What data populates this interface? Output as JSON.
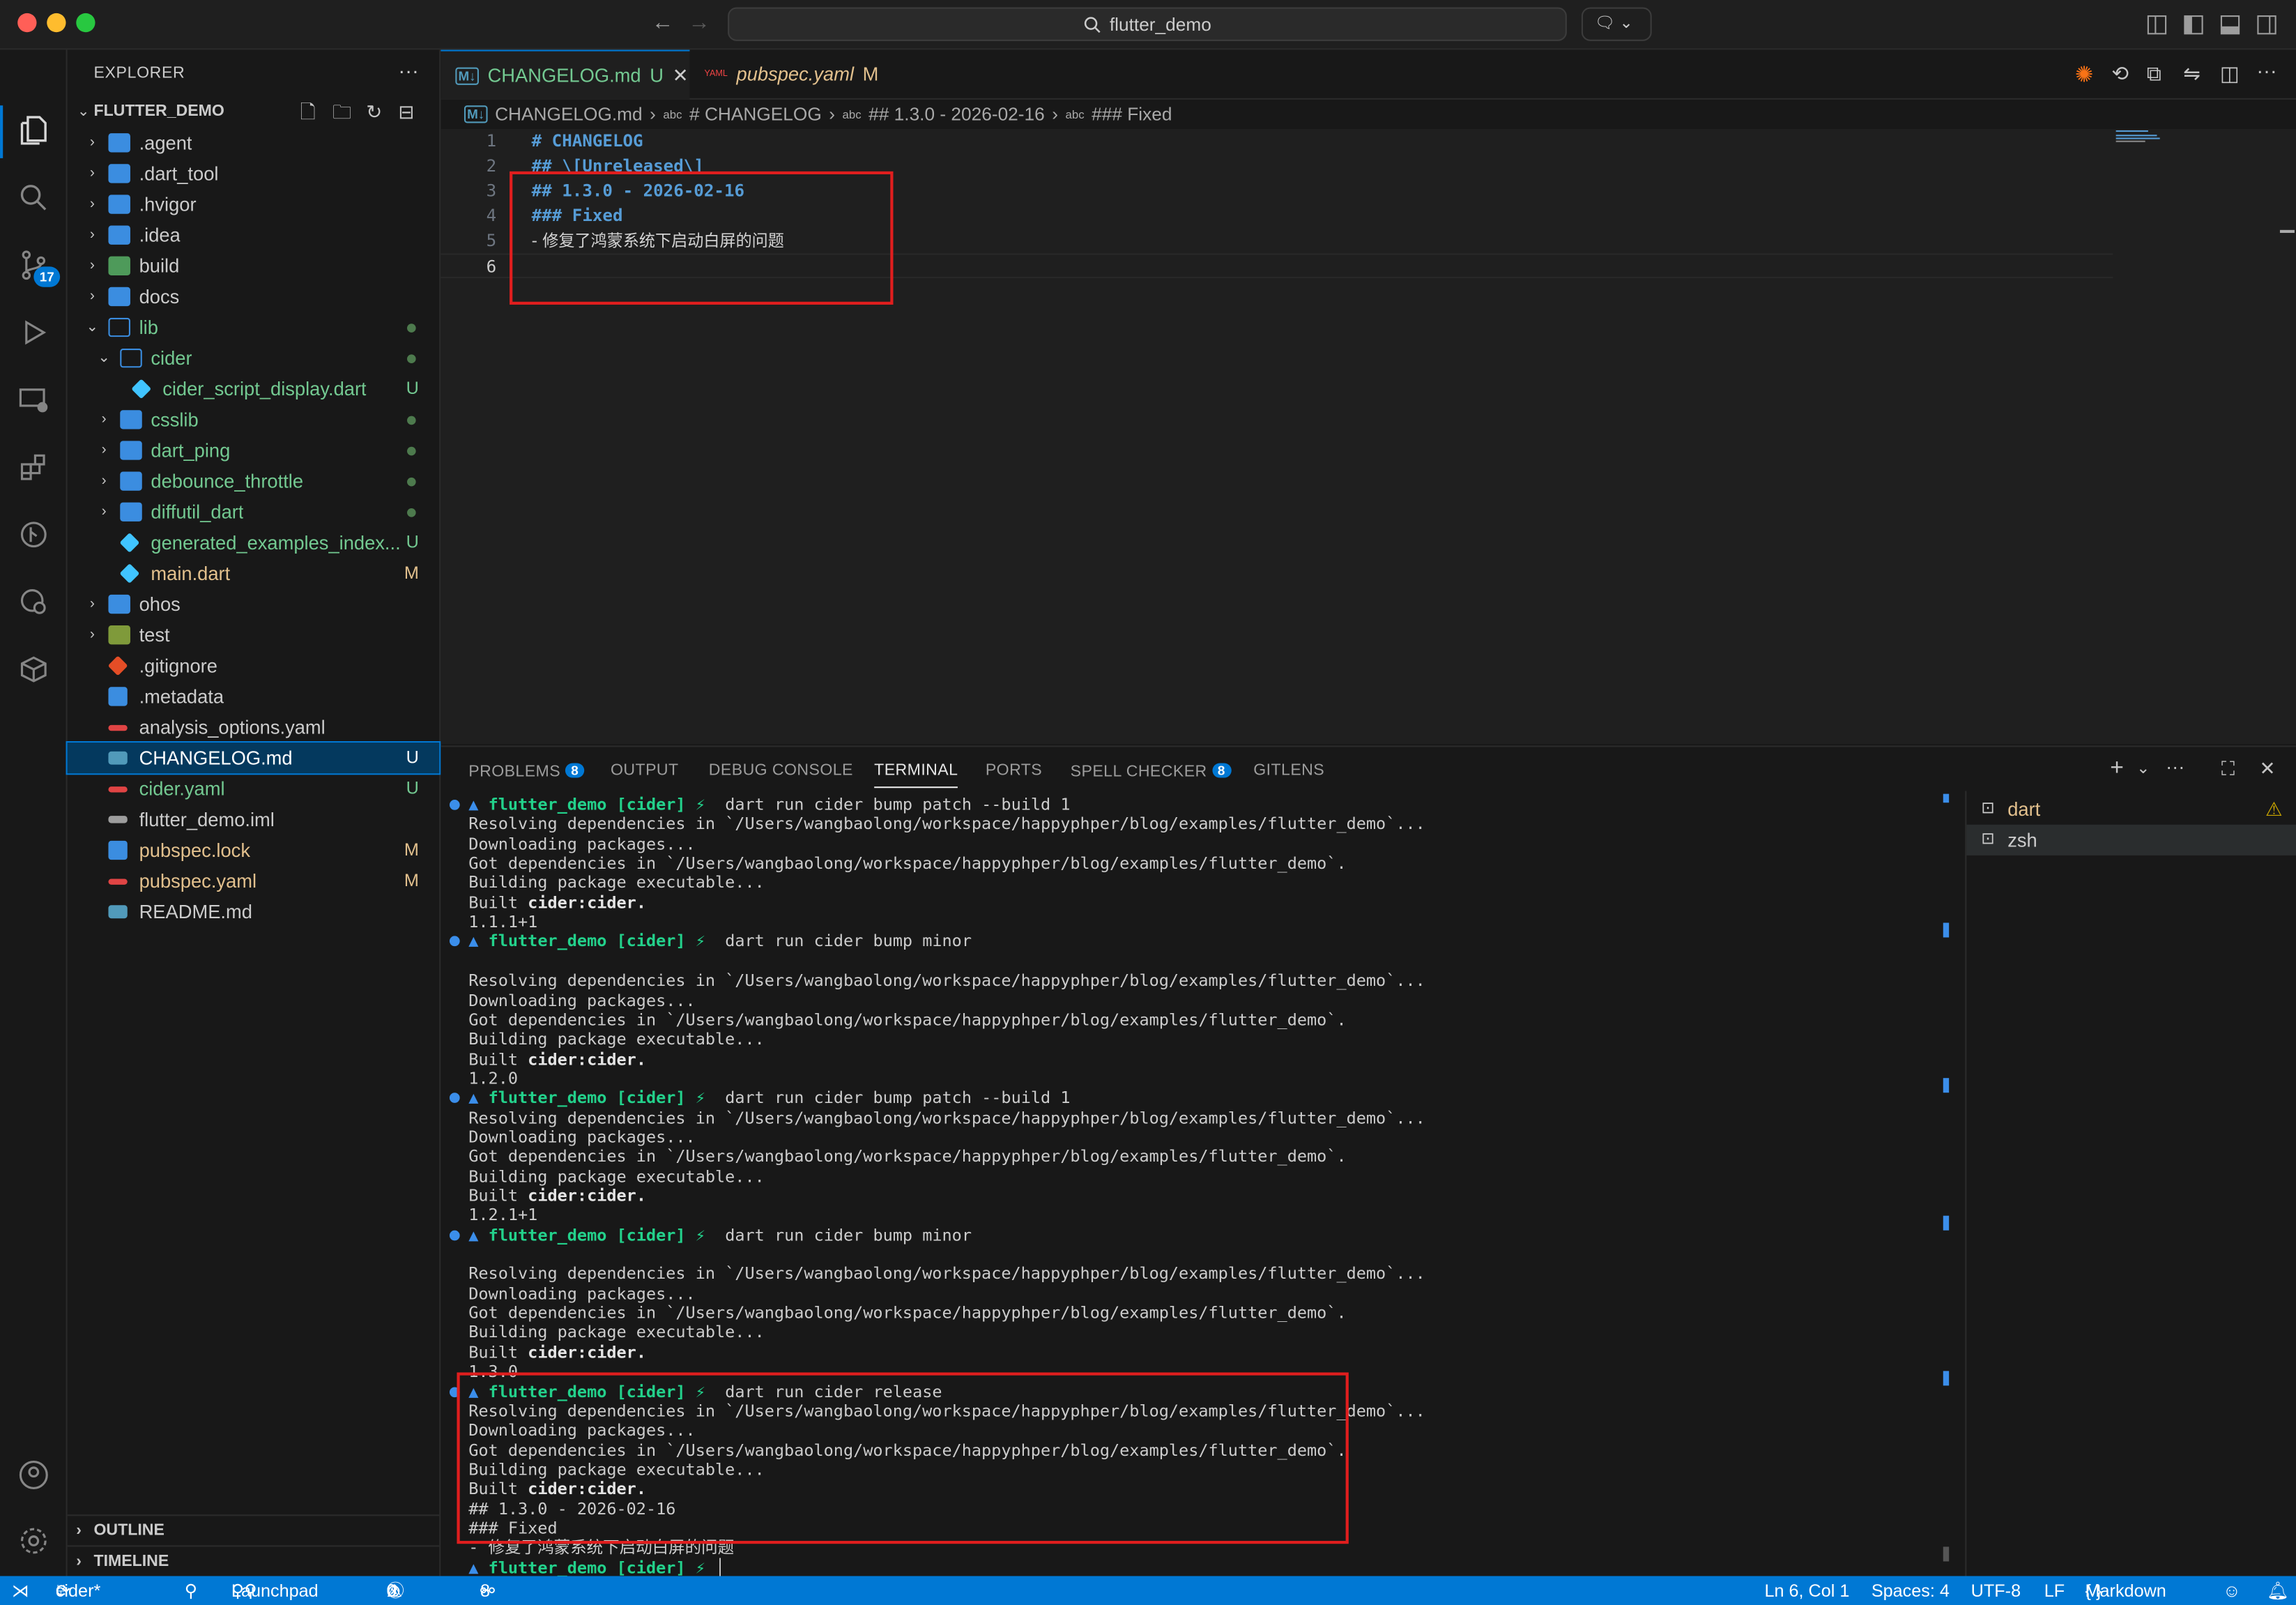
{
  "titlebar": {
    "search": "flutter_demo"
  },
  "explorer": {
    "title": "EXPLORER",
    "workspace": "FLUTTER_DEMO",
    "items": [
      {
        "label": ".agent",
        "status": ""
      },
      {
        "label": ".dart_tool",
        "status": ""
      },
      {
        "label": ".hvigor",
        "status": ""
      },
      {
        "label": ".idea",
        "status": ""
      },
      {
        "label": "build",
        "status": ""
      },
      {
        "label": "docs",
        "status": ""
      },
      {
        "label": "lib",
        "status": ""
      },
      {
        "label": "cider",
        "status": ""
      },
      {
        "label": "cider_script_display.dart",
        "status": "U"
      },
      {
        "label": "csslib",
        "status": ""
      },
      {
        "label": "dart_ping",
        "status": ""
      },
      {
        "label": "debounce_throttle",
        "status": ""
      },
      {
        "label": "diffutil_dart",
        "status": ""
      },
      {
        "label": "generated_examples_index...",
        "status": "U"
      },
      {
        "label": "main.dart",
        "status": "M"
      },
      {
        "label": "ohos",
        "status": ""
      },
      {
        "label": "test",
        "status": ""
      },
      {
        "label": ".gitignore",
        "status": ""
      },
      {
        "label": ".metadata",
        "status": ""
      },
      {
        "label": "analysis_options.yaml",
        "status": ""
      },
      {
        "label": "CHANGELOG.md",
        "status": "U"
      },
      {
        "label": "cider.yaml",
        "status": "U"
      },
      {
        "label": "flutter_demo.iml",
        "status": ""
      },
      {
        "label": "pubspec.lock",
        "status": "M"
      },
      {
        "label": "pubspec.yaml",
        "status": "M"
      },
      {
        "label": "README.md",
        "status": ""
      }
    ],
    "outline": "OUTLINE",
    "timeline": "TIMELINE"
  },
  "activity": {
    "scm_badge": "17"
  },
  "tabs": [
    {
      "label": "CHANGELOG.md",
      "status": "U"
    },
    {
      "label": "pubspec.yaml",
      "status": "M"
    }
  ],
  "breadcrumbs": [
    "CHANGELOG.md",
    "# CHANGELOG",
    "## 1.3.0 - 2026-02-16",
    "### Fixed"
  ],
  "editor": {
    "lines": [
      {
        "num": "1",
        "text": "# CHANGELOG"
      },
      {
        "num": "2",
        "text": "## \\[Unreleased\\]"
      },
      {
        "num": "3",
        "text": "## 1.3.0 - 2026-02-16"
      },
      {
        "num": "4",
        "text": "### Fixed"
      },
      {
        "num": "5",
        "text": "- 修复了鸿蒙系统下启动白屏的问题"
      },
      {
        "num": "6",
        "text": ""
      }
    ]
  },
  "panel": {
    "tabs": [
      "PROBLEMS",
      "OUTPUT",
      "DEBUG CONSOLE",
      "TERMINAL",
      "PORTS",
      "SPELL CHECKER",
      "GITLENS"
    ],
    "problems_count": "8",
    "spell_count": "8",
    "prompt": "flutter_demo [cider] ⚡",
    "commands": [
      "dart run cider bump patch --build 1",
      "dart run cider bump minor",
      "dart run cider bump patch --build 1",
      "dart run cider bump minor",
      "dart run cider release"
    ],
    "resolving": "Resolving dependencies in `/Users/wangbaolong/workspace/happyphper/blog/examples/flutter_demo`...",
    "downloading": "Downloading packages...",
    "got": "Got dependencies in `/Users/wangbaolong/workspace/happyphper/blog/examples/flutter_demo`.",
    "building": "Building package executable...",
    "built_prefix": "Built ",
    "built_name": "cider:cider.",
    "versions": [
      "1.1.1+1",
      "1.2.0",
      "1.2.1+1",
      "1.3.0"
    ],
    "release_out": [
      "## 1.3.0 - 2026-02-16",
      "### Fixed",
      "- 修复了鸿蒙系统下启动白屏的问题"
    ],
    "terminals": [
      "dart",
      "zsh"
    ]
  },
  "status": {
    "branch": "cider*",
    "launchpad": "Launchpad",
    "errors": "0",
    "warnings": "0",
    "info": "0",
    "ports": "8",
    "position": "Ln 6, Col 1",
    "spaces": "Spaces: 4",
    "encoding": "UTF-8",
    "eol": "LF",
    "language": "Markdown"
  }
}
